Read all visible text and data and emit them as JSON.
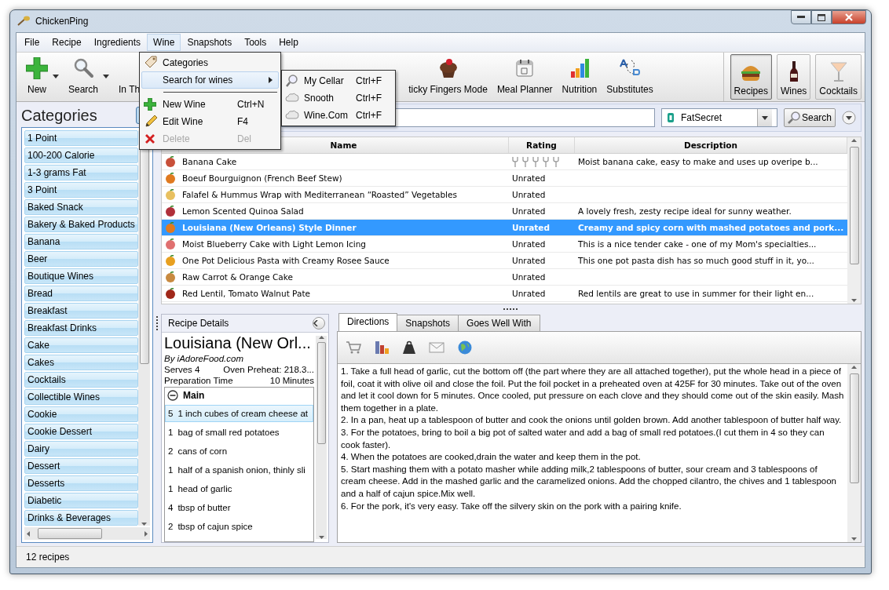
{
  "window": {
    "title": "ChickenPing"
  },
  "menu_bar": [
    {
      "label": "File",
      "selected": false
    },
    {
      "label": "Recipe",
      "selected": false
    },
    {
      "label": "Ingredients",
      "selected": false
    },
    {
      "label": "Wine",
      "selected": true
    },
    {
      "label": "Snapshots",
      "selected": false
    },
    {
      "label": "Tools",
      "selected": false
    },
    {
      "label": "Help",
      "selected": false
    }
  ],
  "toolbar": {
    "items": [
      {
        "label": "New",
        "dropdown": true
      },
      {
        "label": "Search",
        "dropdown": true
      },
      {
        "label": "In Th",
        "dropdown": false
      },
      {
        "label": "ticky Fingers Mode",
        "dropdown": false
      },
      {
        "label": "Meal Planner",
        "dropdown": false
      },
      {
        "label": "Nutrition",
        "dropdown": false
      },
      {
        "label": "Substitutes",
        "dropdown": false
      }
    ],
    "modes": [
      {
        "label": "Recipes",
        "selected": true
      },
      {
        "label": "Wines",
        "selected": false
      },
      {
        "label": "Cocktails",
        "selected": false
      }
    ]
  },
  "categories": {
    "title": "Categories",
    "items": [
      "1 Point",
      "100-200 Calorie",
      "1-3 grams Fat",
      "3 Point",
      "Baked Snack",
      "Bakery & Baked Products",
      "Banana",
      "Beer",
      "Boutique Wines",
      "Bread",
      "Breakfast",
      "Breakfast Drinks",
      "Cake",
      "Cakes",
      "Cocktails",
      "Collectible Wines",
      "Cookie",
      "Cookie Dessert",
      "Dairy",
      "Dessert",
      "Desserts",
      "Diabetic",
      "Drinks & Beverages"
    ]
  },
  "search": {
    "source": "FatSecret",
    "button": "Search"
  },
  "recipes": {
    "columns": [
      "Name",
      "Rating",
      "Description"
    ],
    "rows": [
      {
        "name": "Banana Cake",
        "stars": 0,
        "description": "Moist banana cake, easy to make and uses up overipe b...",
        "selected": false
      },
      {
        "name": "Boeuf Bourguignon (French Beef Stew)",
        "rating": "Unrated",
        "selected": false
      },
      {
        "name": "Falafel & Hummus Wrap with Mediterranean “Roasted” Vegetables",
        "rating": "Unrated",
        "selected": false
      },
      {
        "name": "Lemon Scented Quinoa Salad",
        "rating": "Unrated",
        "description": "A lovely fresh, zesty recipe ideal for sunny weather.",
        "selected": false
      },
      {
        "name": "Louisiana (New Orleans) Style Dinner",
        "rating": "Unrated",
        "description": "Creamy and spicy corn with mashed potatoes and pork...",
        "selected": true
      },
      {
        "name": "Moist Blueberry Cake with Light Lemon Icing",
        "rating": "Unrated",
        "description": "This is a nice tender cake - one of my Mom's specialties...",
        "selected": false
      },
      {
        "name": "One Pot Delicious Pasta with Creamy Rosee Sauce",
        "rating": "Unrated",
        "description": "This one pot pasta dish has so much good stuff in it, yo...",
        "selected": false
      },
      {
        "name": "Raw Carrot & Orange Cake",
        "rating": "Unrated",
        "selected": false
      },
      {
        "name": "Red Lentil, Tomato Walnut Pate",
        "rating": "Unrated",
        "description": "Red lentils are great to use in summer for their light en...",
        "selected": false
      }
    ]
  },
  "recipe_details": {
    "header": "Recipe Details",
    "title": "Louisiana (New Orl...",
    "author": "By iAdoreFood.com",
    "serves": "Serves 4",
    "oven": "Oven Preheat: 218.3...",
    "prep_label": "Preparation Time",
    "prep_value": "10 Minutes",
    "groups": [
      {
        "name": "Main",
        "expanded": true,
        "items": [
          {
            "qty": "5",
            "text": "1 inch cubes of cream cheese at",
            "selected": true
          },
          {
            "qty": "1",
            "text": "bag of small red potatoes",
            "selected": false
          },
          {
            "qty": "2",
            "text": "cans of corn",
            "selected": false
          },
          {
            "qty": "1",
            "text": "half of a spanish onion, thinly sli",
            "selected": false
          },
          {
            "qty": "1",
            "text": "head of garlic",
            "selected": false
          },
          {
            "qty": "4",
            "text": "tbsp of butter",
            "selected": false
          },
          {
            "qty": "2",
            "text": "tbsp of cajun spice",
            "selected": false
          }
        ]
      }
    ]
  },
  "directions": {
    "tabs": [
      {
        "label": "Directions",
        "selected": true
      },
      {
        "label": "Snapshots",
        "selected": false
      },
      {
        "label": "Goes Well With",
        "selected": false
      }
    ],
    "paragraphs": [
      "1. Take a full head of garlic, cut the bottom off (the part where they are all attached together), put the whole head in a piece of foil, coat it with olive oil and close the foil. Put the foil pocket in a preheated oven at 425F for 30 minutes. Take out of the oven and let it cool down for 5 minutes. Once cooled, put pressure on each clove and they should come out of the skin easily. Mash them together in a plate.",
      "2. In a pan, heat up a tablespoon of butter and cook the onions until golden brown. Add another tablespoon of butter half way.",
      "3. For the potatoes, bring to boil a big pot of salted water and add a bag of small red potatoes.(I cut them in 4 so they can cook faster).",
      "4. When the potatoes are cooked,drain the water and keep them in the pot.",
      "5. Start mashing them with a potato masher while adding milk,2 tablespoons of butter, sour cream and 3 tablespoons of cream cheese. Add in the mashed garlic and the caramelized onions. Add the chopped cilantro, the chives and 1 tablespoon and a half of cajun spice.Mix well.",
      "6. For the pork, it's very easy. Take off the silvery skin on the pork with a pairing knife."
    ]
  },
  "status_bar": "12 recipes",
  "wine_menu": {
    "items": [
      {
        "kind": "item",
        "label": "Categories",
        "selected": false,
        "disabled": false
      },
      {
        "kind": "item",
        "label": "Search for wines",
        "submenu": true,
        "selected": true,
        "disabled": false
      },
      {
        "kind": "separator"
      },
      {
        "kind": "item",
        "label": "New Wine",
        "shortcut": "Ctrl+N",
        "selected": false,
        "disabled": false
      },
      {
        "kind": "item",
        "label": "Edit Wine",
        "shortcut": "F4",
        "selected": false,
        "disabled": false
      },
      {
        "kind": "item",
        "label": "Delete",
        "shortcut": "Del",
        "selected": false,
        "disabled": true
      }
    ],
    "submenu": [
      {
        "label": "My Cellar",
        "shortcut": "Ctrl+F"
      },
      {
        "label": "Snooth",
        "shortcut": "Ctrl+F"
      },
      {
        "label": "Wine.Com",
        "shortcut": "Ctrl+F"
      }
    ]
  }
}
